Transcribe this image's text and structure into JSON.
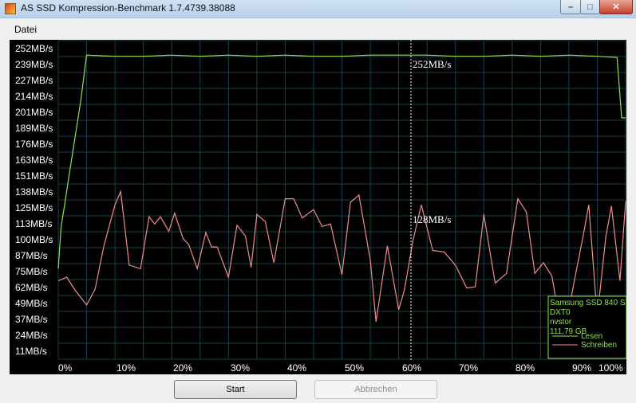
{
  "window": {
    "title": "AS SSD Kompression-Benchmark 1.7.4739.38088",
    "minimize_glyph": "–",
    "maximize_glyph": "□",
    "close_glyph": "✕"
  },
  "menu": {
    "items": [
      "Datei"
    ]
  },
  "buttons": {
    "start": "Start",
    "abort": "Abbrechen"
  },
  "legend": {
    "device": "Samsung SSD 840 S",
    "firmware": "DXT0",
    "driver": "nvstor",
    "capacity": "111,79 GB",
    "read_label": "Lesen",
    "write_label": "Schreiben"
  },
  "colors": {
    "read": "#8fe34b",
    "write": "#f08c8c",
    "grid": "#17414a",
    "text": "#ffffff",
    "legend": "#8fe34b"
  },
  "chart_data": {
    "type": "line",
    "y_tick_labels": [
      "252MB/s",
      "239MB/s",
      "227MB/s",
      "214MB/s",
      "201MB/s",
      "189MB/s",
      "176MB/s",
      "163MB/s",
      "151MB/s",
      "138MB/s",
      "125MB/s",
      "113MB/s",
      "100MB/s",
      "87MB/s",
      "75MB/s",
      "62MB/s",
      "49MB/s",
      "37MB/s",
      "24MB/s",
      "11MB/s"
    ],
    "x_tick_labels": [
      "0%",
      "10%",
      "20%",
      "30%",
      "40%",
      "50%",
      "60%",
      "70%",
      "80%",
      "90%",
      "100%"
    ],
    "xlim": [
      0,
      100
    ],
    "ylim": [
      0,
      264
    ],
    "cursor": {
      "x": 61,
      "read_label": "252MB/s",
      "write_label": "128MB/s"
    },
    "series": [
      {
        "name": "Lesen",
        "x": [
          0,
          0.5,
          1.2,
          2,
          3,
          4,
          4.8,
          5,
          10,
          15,
          20,
          25,
          30,
          35,
          40,
          45,
          50,
          55,
          60,
          61,
          65,
          70,
          75,
          80,
          85,
          90,
          95,
          98.5,
          99.3,
          100
        ],
        "y": [
          75,
          110,
          130,
          155,
          185,
          215,
          245,
          252,
          251,
          251,
          252,
          251,
          252,
          251,
          252,
          251,
          251,
          252,
          252,
          252,
          252,
          251,
          251,
          252,
          251,
          252,
          251,
          250,
          200,
          200
        ]
      },
      {
        "name": "Schreiben",
        "x": [
          0,
          1.5,
          3,
          5,
          6.5,
          8,
          10,
          11,
          12.5,
          14.5,
          16,
          17,
          18,
          19.5,
          20.5,
          22,
          23,
          24.5,
          26,
          27,
          28,
          30,
          31.5,
          33,
          34,
          35,
          36.5,
          38,
          40,
          41.5,
          43,
          45,
          46.5,
          48,
          50,
          51.5,
          53,
          55,
          56,
          58,
          60,
          61,
          62.5,
          64,
          66,
          68,
          70,
          72,
          73.5,
          75,
          77,
          79,
          81,
          82.5,
          84,
          85.5,
          87,
          88.5,
          90,
          91,
          92.5,
          93.5,
          95,
          96.5,
          97.5,
          99,
          100
        ],
        "y": [
          65,
          68,
          57,
          45,
          58,
          93,
          128,
          139,
          78,
          75,
          118,
          112,
          118,
          106,
          121,
          100,
          95,
          75,
          105,
          93,
          93,
          68,
          111,
          102,
          76,
          120,
          114,
          80,
          133,
          133,
          117,
          124,
          110,
          112,
          70,
          130,
          136,
          82,
          31,
          94,
          41,
          57,
          98,
          128,
          90,
          89,
          78,
          59,
          60,
          120,
          63,
          71,
          133,
          122,
          71,
          80,
          69,
          28,
          41,
          66,
          102,
          128,
          35,
          101,
          127,
          65,
          131
        ]
      }
    ]
  }
}
